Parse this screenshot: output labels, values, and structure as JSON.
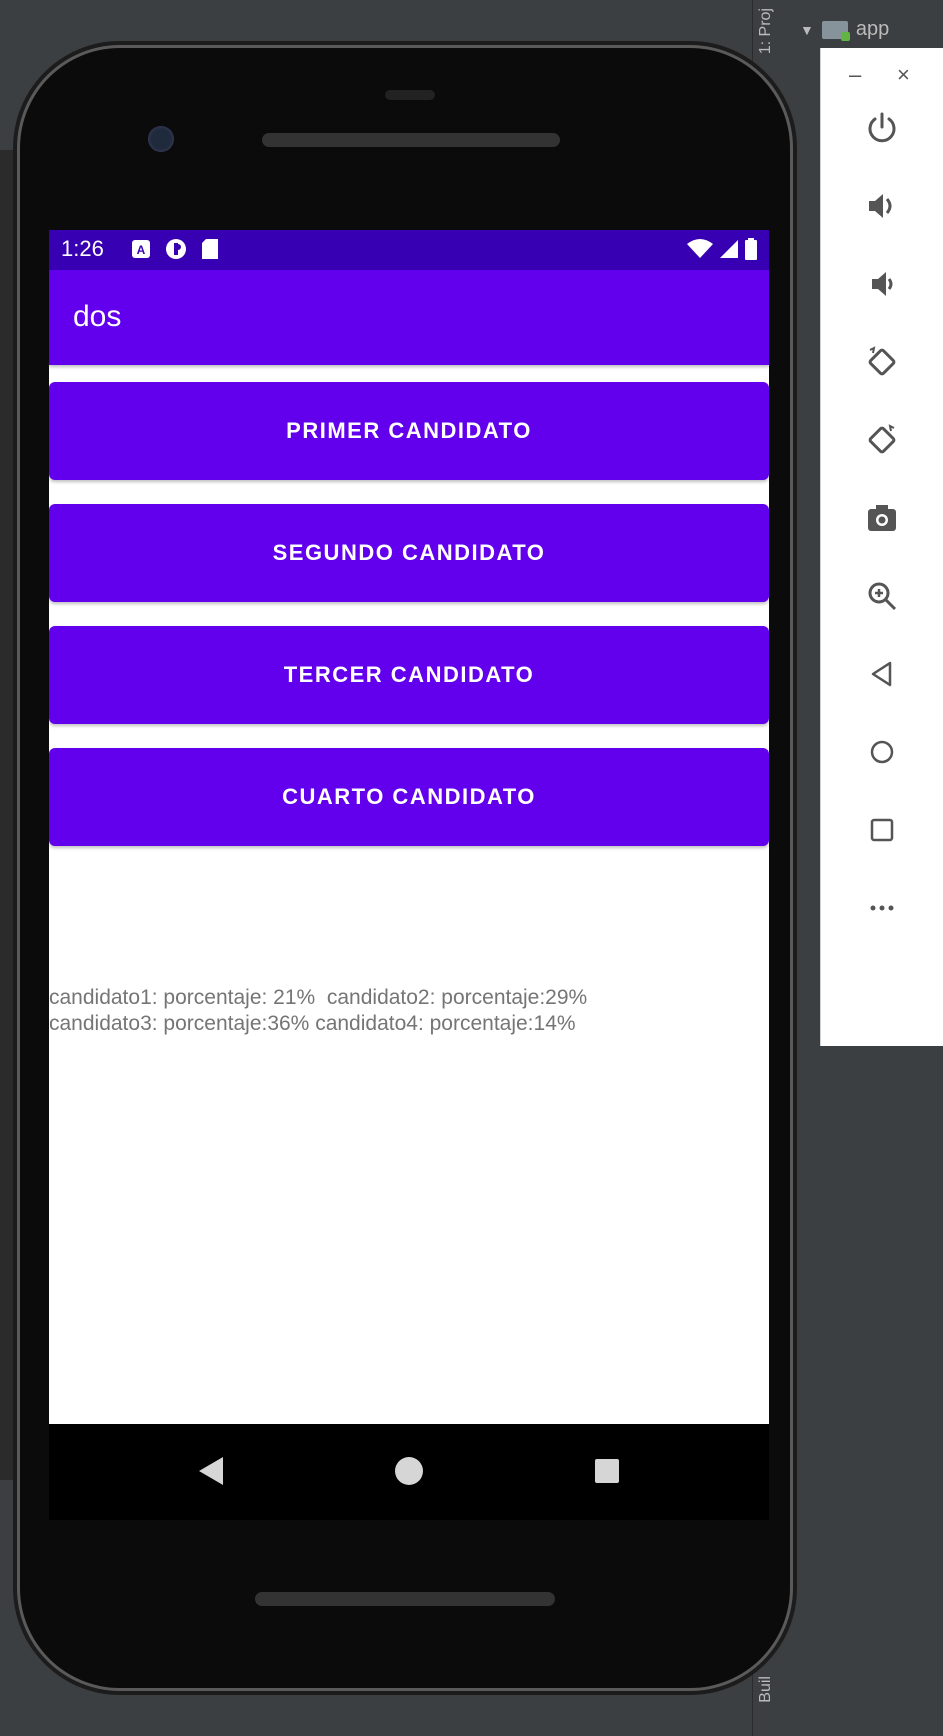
{
  "ide": {
    "project_tab_label": "1: Proj",
    "build_tab_label": "Buil",
    "tree_root": "app",
    "toolbar_minimize": "–",
    "toolbar_close": "×"
  },
  "status_bar": {
    "time": "1:26"
  },
  "app_bar": {
    "title": "dos"
  },
  "buttons": [
    {
      "label": "PRIMER CANDIDATO"
    },
    {
      "label": "SEGUNDO CANDIDATO"
    },
    {
      "label": "TERCER CANDIDATO"
    },
    {
      "label": "CUARTO CANDIDATO"
    }
  ],
  "results": {
    "text": "candidato1: porcentaje: 21%  candidato2: porcentaje:29%\ncandidato3: porcentaje:36% candidato4: porcentaje:14%"
  },
  "colors": {
    "primary": "#6200ee",
    "primary_dark": "#3700b3",
    "text_secondary": "#757575"
  },
  "emulator_toolbar": [
    {
      "icon": "power-icon"
    },
    {
      "icon": "volume-up-icon"
    },
    {
      "icon": "volume-down-icon"
    },
    {
      "icon": "rotate-left-icon"
    },
    {
      "icon": "rotate-right-icon"
    },
    {
      "icon": "camera-icon"
    },
    {
      "icon": "zoom-icon"
    },
    {
      "icon": "back-icon"
    },
    {
      "icon": "home-icon"
    },
    {
      "icon": "overview-icon"
    },
    {
      "icon": "more-icon"
    }
  ]
}
